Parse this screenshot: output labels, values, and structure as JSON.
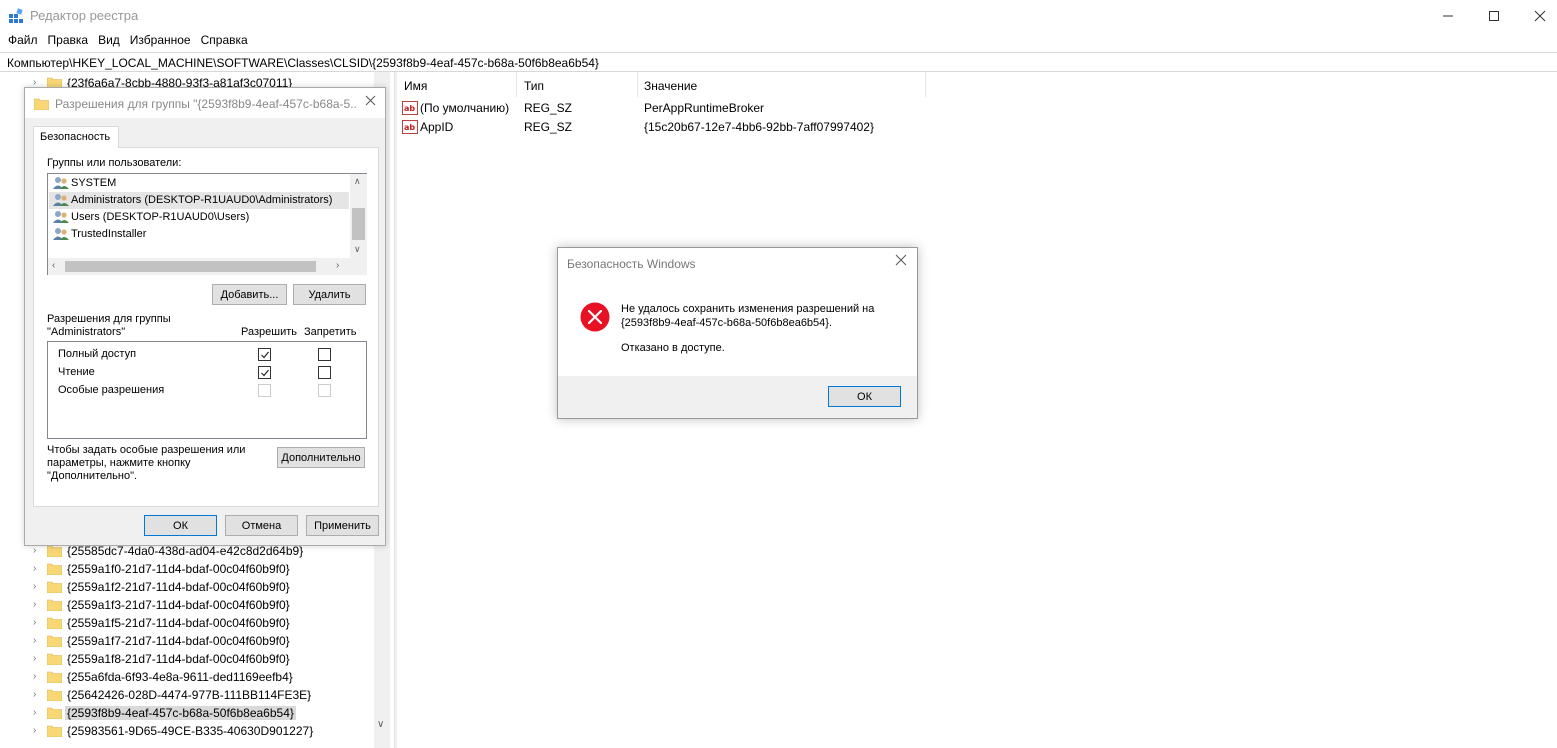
{
  "window": {
    "title": "Редактор реестра"
  },
  "menu": [
    "Файл",
    "Правка",
    "Вид",
    "Избранное",
    "Справка"
  ],
  "address": "Компьютер\\HKEY_LOCAL_MACHINE\\SOFTWARE\\Classes\\CLSID\\{2593f8b9-4eaf-457c-b68a-50f6b8ea6b54}",
  "tree": {
    "top_item": "{23f6a6a7-8cbb-4880-93f3-a81af3c07011}",
    "items": [
      "{25585dc7-4da0-438d-ad04-e42c8d2d64b9}",
      "{2559a1f0-21d7-11d4-bdaf-00c04f60b9f0}",
      "{2559a1f2-21d7-11d4-bdaf-00c04f60b9f0}",
      "{2559a1f3-21d7-11d4-bdaf-00c04f60b9f0}",
      "{2559a1f5-21d7-11d4-bdaf-00c04f60b9f0}",
      "{2559a1f7-21d7-11d4-bdaf-00c04f60b9f0}",
      "{2559a1f8-21d7-11d4-bdaf-00c04f60b9f0}",
      "{255a6fda-6f93-4e8a-9611-ded1169eefb4}",
      "{25642426-028D-4474-977B-111BB114FE3E}",
      "{2593f8b9-4eaf-457c-b68a-50f6b8ea6b54}",
      "{25983561-9D65-49CE-B335-40630D901227}"
    ],
    "selected_index": 9
  },
  "list": {
    "headers": {
      "name": "Имя",
      "type": "Тип",
      "value": "Значение"
    },
    "rows": [
      {
        "name": "(По умолчанию)",
        "type": "REG_SZ",
        "value": "PerAppRuntimeBroker"
      },
      {
        "name": "AppID",
        "type": "REG_SZ",
        "value": "{15c20b67-12e7-4bb6-92bb-7aff07997402}"
      }
    ]
  },
  "perm_dialog": {
    "title": "Разрешения для группы \"{2593f8b9-4eaf-457c-b68a-5...",
    "tab": "Безопасность",
    "groups_label": "Группы или пользователи:",
    "users": [
      "SYSTEM",
      "Administrators (DESKTOP-R1UAUD0\\Administrators)",
      "Users (DESKTOP-R1UAUD0\\Users)",
      "TrustedInstaller"
    ],
    "selected_user": 1,
    "add_button": "Добавить...",
    "remove_button": "Удалить",
    "perm_label_line1": "Разрешения для группы",
    "perm_label_line2": "\"Administrators\"",
    "allow_header": "Разрешить",
    "deny_header": "Запретить",
    "permissions": [
      {
        "name": "Полный доступ",
        "allow": true,
        "deny": false,
        "disabled": false
      },
      {
        "name": "Чтение",
        "allow": true,
        "deny": false,
        "disabled": false
      },
      {
        "name": "Особые разрешения",
        "allow": false,
        "deny": false,
        "disabled": true
      }
    ],
    "advanced_text_1": "Чтобы задать особые разрешения или",
    "advanced_text_2": "параметры, нажмите кнопку",
    "advanced_text_3": "\"Дополнительно\".",
    "advanced_button": "Дополнительно",
    "ok_button": "ОК",
    "cancel_button": "Отмена",
    "apply_button": "Применить"
  },
  "error_dialog": {
    "title": "Безопасность Windows",
    "message_line1": "Не удалось сохранить изменения разрешений на",
    "message_line2": "{2593f8b9-4eaf-457c-b68a-50f6b8ea6b54}.",
    "message_2": "Отказано в доступе.",
    "ok_button": "ОК"
  },
  "colors": {
    "error_red": "#e81123",
    "folder_yellow": "#f8d775",
    "accent_blue": "#0078d7"
  }
}
